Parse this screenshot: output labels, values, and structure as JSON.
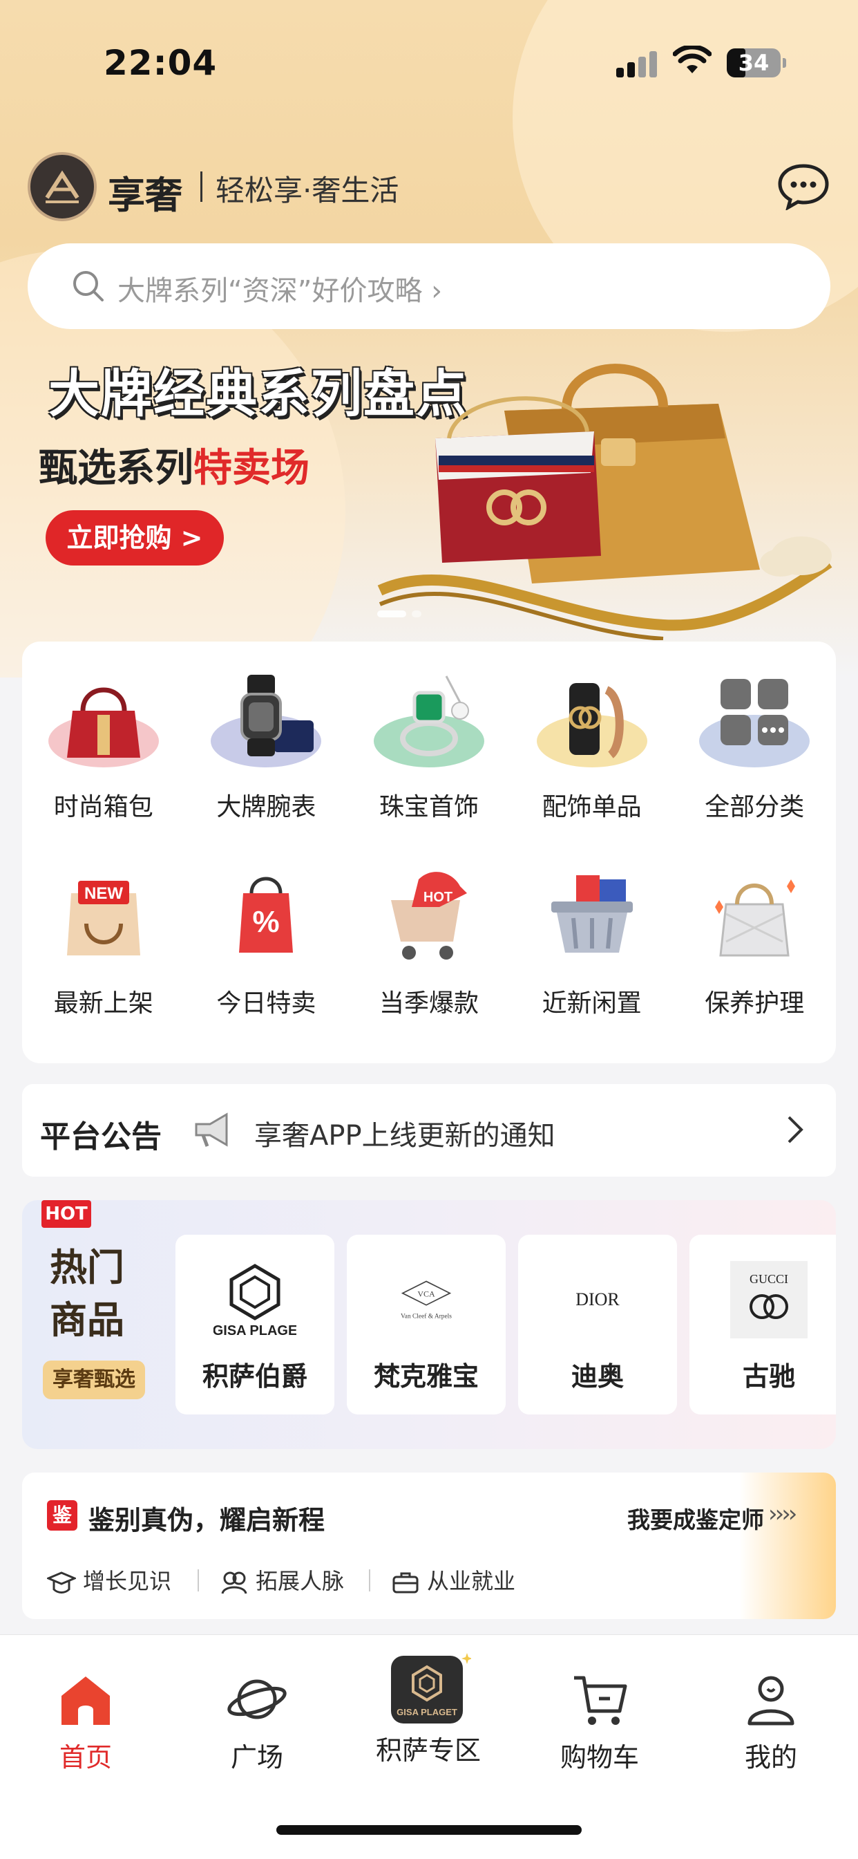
{
  "status_bar": {
    "time": "22:04",
    "battery": "34",
    "battery_level": 0.34
  },
  "header": {
    "brand_name": "享奢",
    "slogan": "轻松享·奢生活"
  },
  "search": {
    "placeholder": "大牌系列“资深”好价攻略 ›"
  },
  "banner": {
    "title": "大牌经典系列盘点",
    "subtitle_part1": "甄选系列",
    "subtitle_part2": "特卖场",
    "cta_label": "立即抢购 >"
  },
  "categories": [
    {
      "label": "时尚箱包",
      "icon": "handbag-icon"
    },
    {
      "label": "大牌腕表",
      "icon": "watch-icon"
    },
    {
      "label": "珠宝首饰",
      "icon": "jewelry-icon"
    },
    {
      "label": "配饰单品",
      "icon": "belt-icon"
    },
    {
      "label": "全部分类",
      "icon": "all-categories-icon"
    },
    {
      "label": "最新上架",
      "icon": "new-arrival-icon"
    },
    {
      "label": "今日特卖",
      "icon": "sale-tag-icon"
    },
    {
      "label": "当季爆款",
      "icon": "hot-cart-icon"
    },
    {
      "label": "近新闲置",
      "icon": "basket-icon"
    },
    {
      "label": "保养护理",
      "icon": "bag-care-icon"
    }
  ],
  "category_badges": {
    "new": "NEW",
    "hot": "HOT",
    "percent": "%"
  },
  "notice": {
    "title": "平台公告",
    "text": "享奢APP上线更新的通知"
  },
  "hot_products": {
    "tag": "HOT",
    "title": "热门商品",
    "pill": "享奢甄选",
    "brands": [
      {
        "name": "积萨伯爵",
        "logo_text": "GISA PLAGE"
      },
      {
        "name": "梵克雅宝",
        "logo_text": "Van Cleef & Arpels"
      },
      {
        "name": "迪奥",
        "logo_text": "DIOR"
      },
      {
        "name": "古驰",
        "logo_text": "GUCCI"
      }
    ]
  },
  "appraiser": {
    "badge": "鉴",
    "title": "鉴别真伪，耀启新程",
    "link": "我要成鉴定师",
    "arrows": "››››",
    "features": [
      "增长见识",
      "拓展人脉",
      "从业就业"
    ]
  },
  "tabbar": {
    "items": [
      {
        "label": "首页",
        "icon": "home-icon",
        "active": true
      },
      {
        "label": "广场",
        "icon": "planet-icon",
        "active": false
      },
      {
        "label": "积萨专区",
        "icon": "gisa-plaget-icon",
        "active": false
      },
      {
        "label": "购物车",
        "icon": "cart-icon",
        "active": false
      },
      {
        "label": "我的",
        "icon": "profile-icon",
        "active": false
      }
    ],
    "center_logo_text": "GISA PLAGET"
  },
  "colors": {
    "accent_red": "#e02a2a",
    "gold": "#f4d18e",
    "header_bg": "#f6dcae"
  }
}
